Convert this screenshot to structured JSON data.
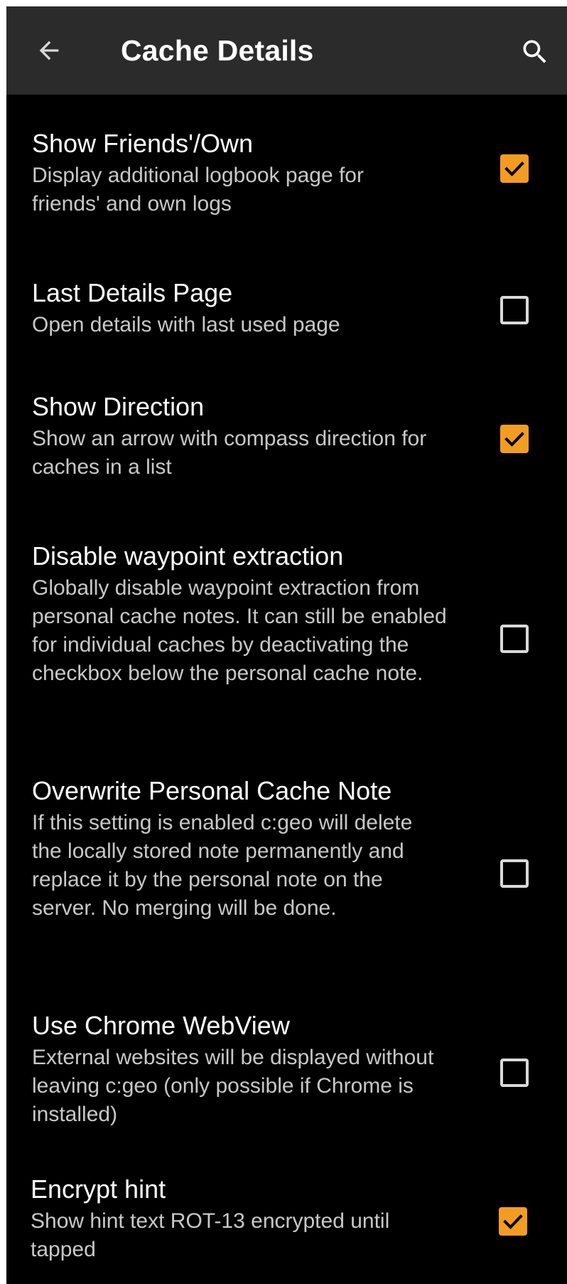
{
  "app_bar": {
    "title": "Cache Details",
    "back_icon": "arrow-left-icon",
    "search_icon": "search-icon",
    "background": "#2b2b2b"
  },
  "colors": {
    "accent": "#f39c22",
    "background": "#000000",
    "title_text": "#ffffff",
    "summary_text": "#c8c8c8"
  },
  "preferences": [
    {
      "title": "Show Friends'/Own",
      "summary": "Display additional logbook page for friends' and own logs",
      "checked": true
    },
    {
      "title": "Last Details Page",
      "summary": "Open details with last used page",
      "checked": false
    },
    {
      "title": "Show Direction",
      "summary": "Show an arrow with compass direction for caches in a list",
      "checked": true
    },
    {
      "title": "Disable waypoint extraction",
      "summary": "Globally disable waypoint extraction from personal cache notes. It can still be enabled for individual caches by deactivating the checkbox below the personal cache note.",
      "checked": false
    },
    {
      "title": "Overwrite Personal Cache Note",
      "summary": "If this setting is enabled c:geo will delete the locally stored note permanently and replace it by the personal note on the server. No merging will be done.",
      "checked": false
    },
    {
      "title": "Use Chrome WebView",
      "summary": "External websites will be displayed without leaving c:geo (only possible if Chrome is installed)",
      "checked": false
    },
    {
      "title": "Encrypt hint",
      "summary": "Show hint text ROT-13 encrypted until tapped",
      "checked": true
    }
  ]
}
